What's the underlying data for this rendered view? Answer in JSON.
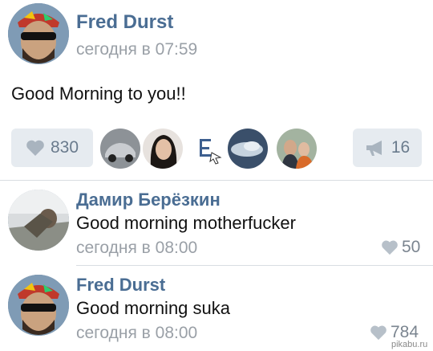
{
  "post": {
    "author": "Fred Durst",
    "time": "сегодня в 07:59",
    "text": "Good Morning to you!!",
    "likes": "830",
    "reposts": "16"
  },
  "comments": [
    {
      "author": "Дамир Берёзкин",
      "text": "Good morning motherfucker",
      "time": "сегодня в 08:00",
      "likes": "50"
    },
    {
      "author": "Fred Durst",
      "text": "Good morning suka",
      "time": "сегодня в 08:00",
      "likes": "784"
    }
  ],
  "watermark": "pikabu.ru",
  "colors": {
    "name": "#4a6d93",
    "meta": "#9aa0a7",
    "chip_bg": "#e6ebf0",
    "icon": "#a9b4bf"
  }
}
